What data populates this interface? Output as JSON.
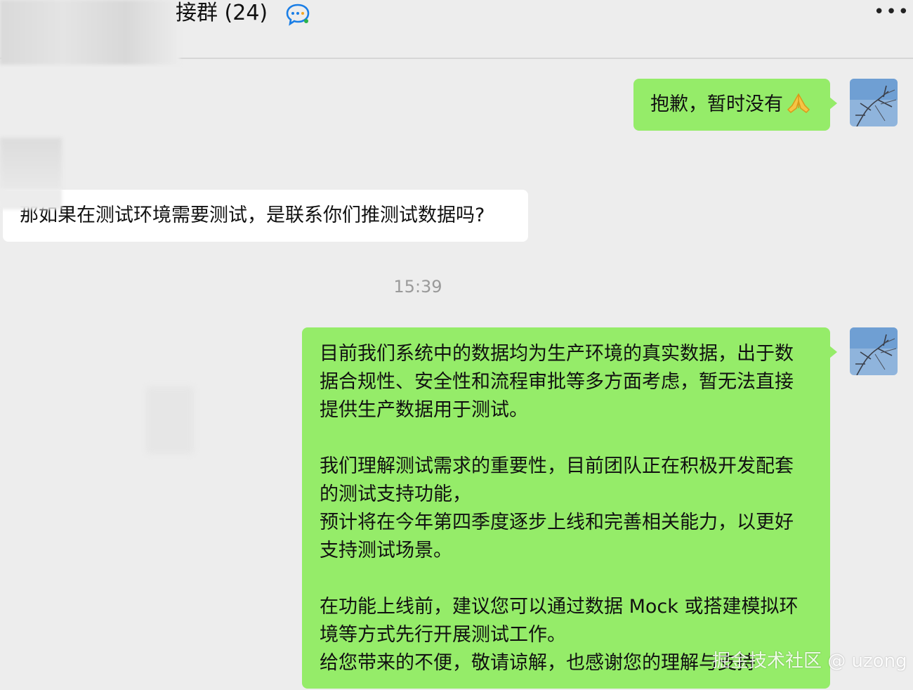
{
  "header": {
    "title": "接群 (24)",
    "more_label": "•••",
    "chat_icon": "group-chat-icon"
  },
  "messages": [
    {
      "id": "m1",
      "side": "right",
      "text": "抱歉，暂时没有",
      "emoji_icon": "folded-hands-icon"
    },
    {
      "id": "m2",
      "side": "left",
      "text": "那如果在测试环境需要测试，是联系你们推测试数据吗?"
    },
    {
      "id": "time1",
      "type": "timestamp",
      "text": "15:39"
    },
    {
      "id": "m3",
      "side": "right",
      "paragraphs": [
        [
          "目前我们系统中的数据均为生产环境的真实数据，出于数",
          "据合规性、安全性和流程审批等多方面考虑，暂无法直接",
          "提供生产数据用于测试。"
        ],
        [
          "我们理解测试需求的重要性，目前团队正在积极开发配套",
          "的测试支持功能，",
          "预计将在今年第四季度逐步上线和完善相关能力，以更好",
          "支持测试场景。"
        ],
        [
          "在功能上线前，建议您可以通过数据 Mock 或搭建模拟环",
          "境等方式先行开展测试工作。",
          "给您带来的不便，敬请谅解，也感谢您的理解与支持"
        ]
      ]
    }
  ],
  "watermark": "掘金技术社区 @ uzong",
  "colors": {
    "background": "#ededed",
    "bubble_green": "#95ec69",
    "bubble_white": "#ffffff",
    "timestamp": "#9a9a9a"
  }
}
